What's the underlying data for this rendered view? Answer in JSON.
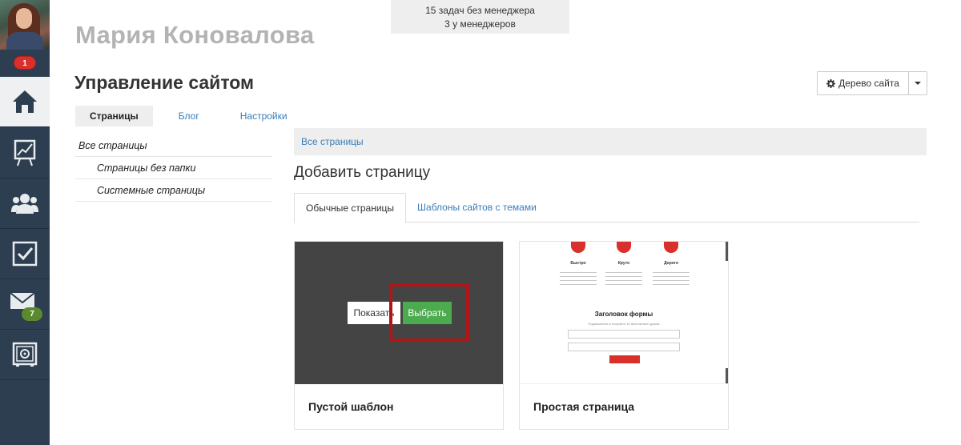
{
  "user": {
    "name": "Мария Коновалова",
    "notifications": "1"
  },
  "tasks": {
    "line1": "15 задач без менеджера",
    "line2": "3 у менеджеров"
  },
  "nav": {
    "mail_badge": "7"
  },
  "page": {
    "title": "Управление сайтом"
  },
  "site_tree": {
    "label": "Дерево сайта"
  },
  "tabs": [
    {
      "label": "Страницы"
    },
    {
      "label": "Блог"
    },
    {
      "label": "Настройки"
    }
  ],
  "folders": [
    {
      "label": "Все страницы"
    },
    {
      "label": "Страницы без папки"
    },
    {
      "label": "Системные страницы"
    }
  ],
  "breadcrumb": {
    "label": "Все страницы"
  },
  "add_page": {
    "title": "Добавить страницу"
  },
  "sub_tabs": [
    {
      "label": "Обычные страницы"
    },
    {
      "label": "Шаблоны сайтов с темами"
    }
  ],
  "templates": [
    {
      "name": "Пустой шаблон",
      "show_label": "Показать",
      "choose_label": "Выбрать"
    },
    {
      "name": "Простая страница",
      "preview": {
        "features": [
          "Быстро",
          "Круто",
          "Дорого"
        ],
        "form_title": "Заголовок формы",
        "form_subtitle": "Подпишитесь и получите 10 бесплатных уроков"
      }
    }
  ],
  "colors": {
    "accent_red": "#d9302c",
    "accent_green": "#4caa4f",
    "link": "#3a7cb8",
    "sidebar": "#2c3e50",
    "highlight": "#b01517"
  }
}
